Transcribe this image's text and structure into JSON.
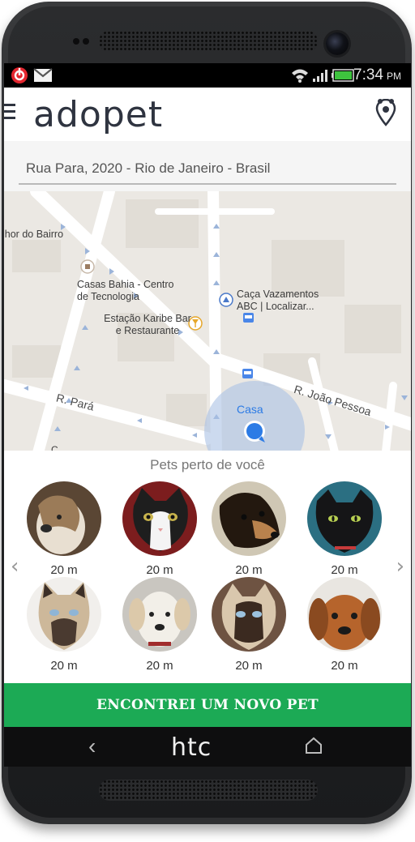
{
  "statusbar": {
    "time": "7:34",
    "ampm": "PM",
    "icons": [
      "beats-icon",
      "gmail-icon",
      "wifi-icon",
      "signal-icon",
      "battery-icon"
    ]
  },
  "app": {
    "title": "adopet",
    "menu_icon": "hamburger-icon",
    "location_icon": "map-pin-icon"
  },
  "address": {
    "value": "Rua Para, 2020 - Rio de Janeiro - Brasil"
  },
  "map": {
    "labels": [
      {
        "text": "lhor do Bairro"
      },
      {
        "text": "Casas Bahia - Centro de Tecnologia"
      },
      {
        "text": "Estação Karibe Bar e Restaurante"
      },
      {
        "text": "Caça Vazamentos ABC | Localizar..."
      },
      {
        "text": "Casa"
      }
    ],
    "roads": [
      "R. Pará",
      "R. João Pessoa"
    ]
  },
  "pets_section": {
    "title": "Pets perto de você",
    "prev_icon": "chevron-left-icon",
    "next_icon": "chevron-right-icon",
    "pets": [
      {
        "kind": "dog",
        "distance": "20 m",
        "color": "#8a6a4f"
      },
      {
        "kind": "cat",
        "distance": "20 m",
        "color": "#222222"
      },
      {
        "kind": "dog",
        "distance": "20 m",
        "color": "#3a2a1d"
      },
      {
        "kind": "cat",
        "distance": "20 m",
        "color": "#1f1f22"
      },
      {
        "kind": "cat",
        "distance": "20 m",
        "color": "#c8b59a"
      },
      {
        "kind": "dog",
        "distance": "20 m",
        "color": "#e6e2da"
      },
      {
        "kind": "cat",
        "distance": "20 m",
        "color": "#8b6f57"
      },
      {
        "kind": "dog",
        "distance": "20 m",
        "color": "#b5662d"
      }
    ]
  },
  "cta": {
    "label": "ENCONTREI UM NOVO PET",
    "color": "#1caa55"
  },
  "navbar": {
    "brand": "htc",
    "back_icon": "back-icon",
    "home_icon": "home-icon"
  }
}
